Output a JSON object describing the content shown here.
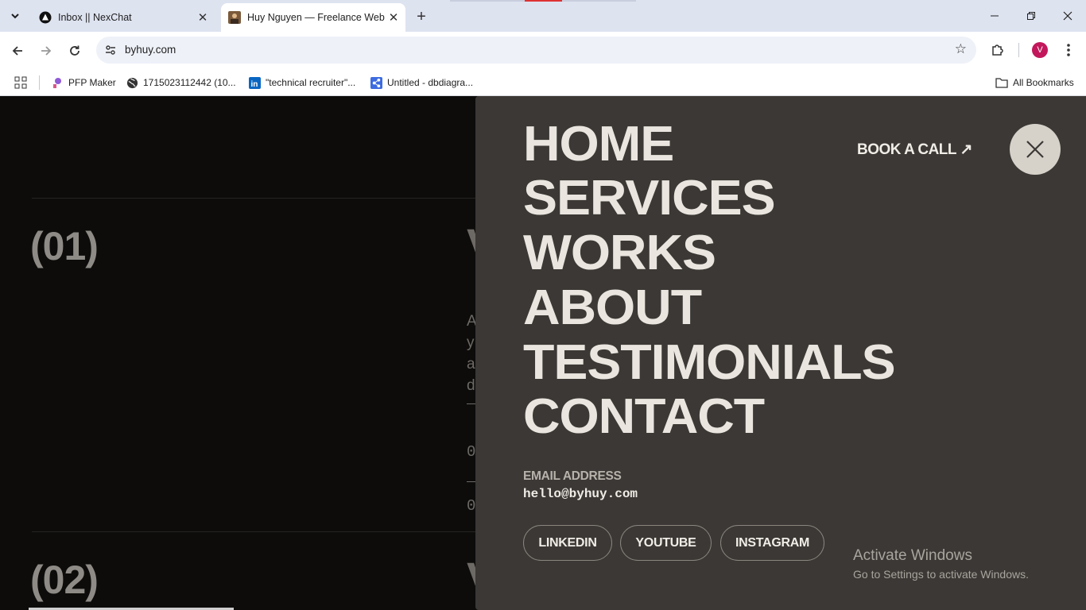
{
  "browser": {
    "tabs": [
      {
        "title": "Inbox || NexChat",
        "active": false
      },
      {
        "title": "Huy Nguyen — Freelance Web",
        "active": true
      }
    ],
    "url": "byhuy.com",
    "profile_initial": "V",
    "bookmarks": [
      {
        "label": "PFP Maker"
      },
      {
        "label": "1715023112442 (10..."
      },
      {
        "label": "\"technical recruiter\"..."
      },
      {
        "label": "Untitled - dbdiagra..."
      }
    ],
    "all_bookmarks": "All Bookmarks"
  },
  "page": {
    "sections": [
      {
        "number": "(01)",
        "peek_letter": "V"
      },
      {
        "number": "(02)",
        "peek_letter": "V"
      }
    ],
    "peek_lines": [
      "A",
      "y",
      "a",
      "d"
    ],
    "peek_digits": [
      "0",
      "0"
    ]
  },
  "overlay": {
    "nav": [
      "HOME",
      "SERVICES",
      "WORKS",
      "ABOUT",
      "TESTIMONIALS",
      "CONTACT"
    ],
    "book_call": "BOOK A CALL ↗",
    "email_label": "EMAIL ADDRESS",
    "email": "hello@byhuy.com",
    "socials": [
      "LINKEDIN",
      "YOUTUBE",
      "INSTAGRAM"
    ]
  },
  "watermark": {
    "title": "Activate Windows",
    "subtitle": "Go to Settings to activate Windows."
  }
}
